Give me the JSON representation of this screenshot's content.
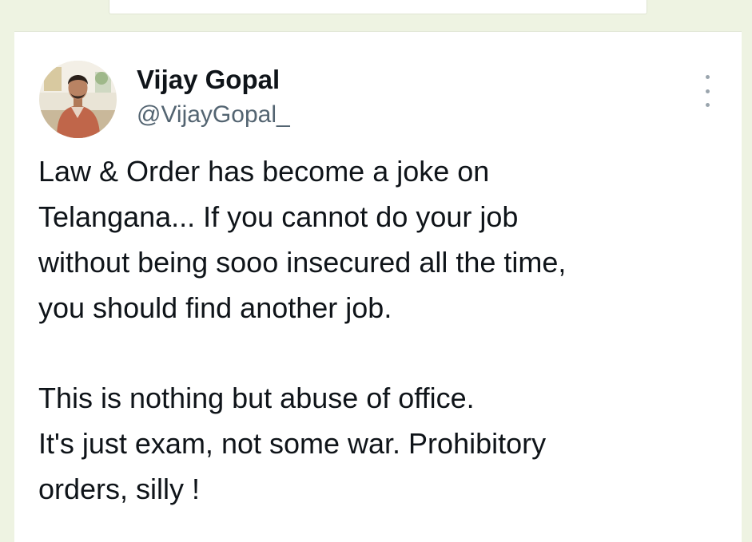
{
  "tweet": {
    "author": {
      "display_name": "Vijay Gopal",
      "handle": "@VijayGopal_",
      "avatar_icon": "user-avatar-photo"
    },
    "more_icon": "more-vertical-icon",
    "paragraph_1": [
      "Law & Order has become a joke on",
      "Telangana... If you cannot do your job",
      "without being sooo insecured all the time,",
      "you should find another job."
    ],
    "paragraph_2": [
      "This is nothing but abuse of office.",
      "It's just exam, not some war. Prohibitory",
      "orders, silly !"
    ]
  },
  "colors": {
    "page_background": "#eef3e2",
    "card_background": "#ffffff",
    "primary_text": "#0f1419",
    "secondary_text": "#536471"
  }
}
